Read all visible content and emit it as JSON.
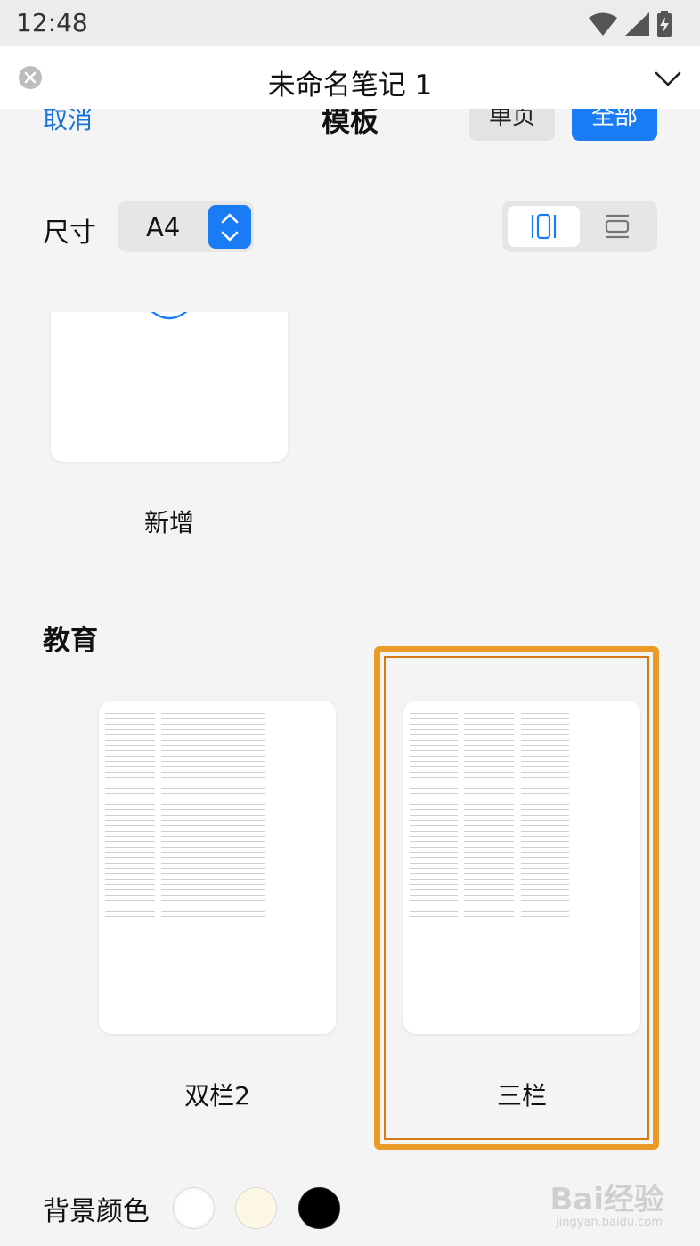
{
  "status_bar": {
    "time": "12:48"
  },
  "note_header": {
    "title": "未命名笔记 1"
  },
  "panel": {
    "cancel": "取消",
    "title": "模板",
    "segment_single": "单页",
    "segment_all": "全部"
  },
  "size": {
    "label": "尺寸",
    "value": "A4"
  },
  "templates": {
    "add_label": "新增",
    "section_title": "教育",
    "items": [
      {
        "label": "双栏2"
      },
      {
        "label": "三栏"
      }
    ]
  },
  "background": {
    "label": "背景颜色",
    "swatches": [
      "#ffffff",
      "#fdf8e6",
      "#000000"
    ]
  },
  "watermark": {
    "brand": "Bai经验",
    "url": "jingyan.baidu.com"
  },
  "colors": {
    "accent": "#1a7cf5",
    "highlight": "#eb9a28"
  }
}
